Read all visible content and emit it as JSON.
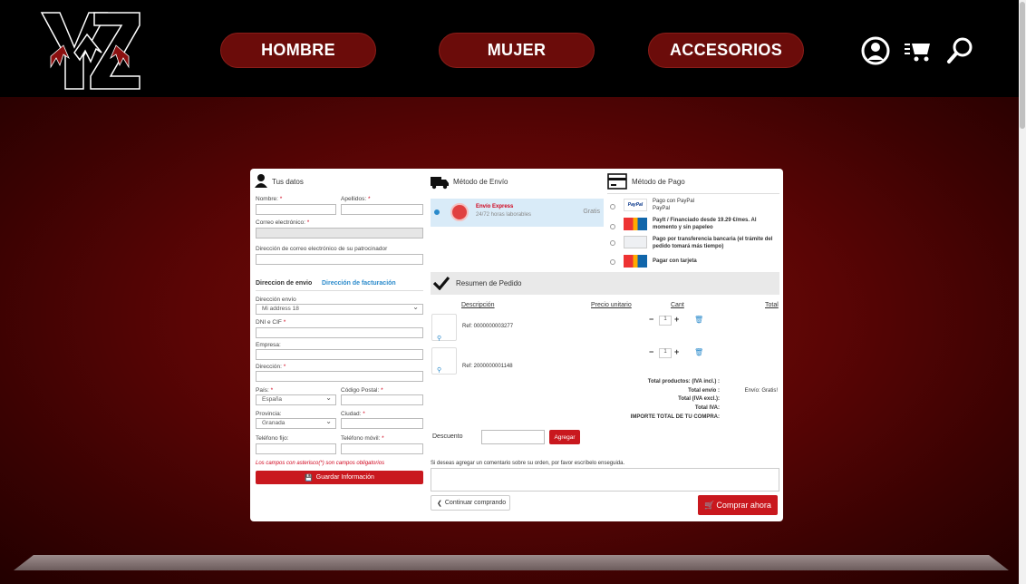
{
  "nav": {
    "hombre": "HOMBRE",
    "mujer": "MUJER",
    "accesorios": "ACCESORIOS"
  },
  "colors": {
    "brand_dark": "#6b0c0a",
    "accent_red": "#c9181e",
    "link_blue": "#2a8acb"
  },
  "datos": {
    "title": "Tus datos",
    "nombre": "Nombre: ",
    "apellidos": "Apellidos: ",
    "correo": "Correo electrónico: ",
    "correo_padrinador": "Dirección de correo electrónico de su patrocinador",
    "tab_envio": "Direccion de envio",
    "tab_facturacion": "Dirección de facturación",
    "direccion_envio": "Dirección envío",
    "direccion_envio_value": "Mi address 18",
    "dni": "DNI e CIF ",
    "empresa": "Empresa:",
    "direccion": "Dirección: ",
    "pais": "País: ",
    "pais_value": "España",
    "cp": "Código Postal: ",
    "provincia": "Provincia:",
    "provincia_value": "Granada",
    "ciudad": "Ciudad: ",
    "tel_fijo": "Teléfono fijo:",
    "tel_movil": "Teléfono móvil: ",
    "nota": "Los campos con asterisco(*) son campos obligatorios",
    "guardar": "Guardar Información",
    "asterisk": "*"
  },
  "envio": {
    "title": "Método de Envío",
    "option_name": "Envío Express",
    "option_desc": "24/72 horas laborables",
    "option_price": "Gratis"
  },
  "pago": {
    "title": "Método de Pago",
    "options": [
      {
        "label": "Pago con PayPal",
        "sub": "PayPal",
        "icon": "PayPal"
      },
      {
        "label": "Paylt / Financiado desde 19.29 €/mes. Al momento y sin papeleo",
        "sub": ""
      },
      {
        "label": "Pago por transferencia bancaria (el trámite del pedido tomará más tiempo)",
        "sub": ""
      },
      {
        "label": "Pagar con tarjeta",
        "sub": ""
      }
    ]
  },
  "resumen": {
    "title": "Resumen de Pedido",
    "headers": {
      "descripcion": "Descripción",
      "precio": "Precio unitario",
      "cant": "Cant",
      "total": "Total"
    },
    "items": [
      {
        "ref": "Ref: 0000000003277",
        "qty": "1"
      },
      {
        "ref": "Ref: 2000000001148",
        "qty": "1"
      }
    ],
    "totales": {
      "productos": "Total productos: (IVA incl.) :",
      "envio": "Total envío :",
      "envio_value": "Envío: Gratis!",
      "sin_iva": "Total (IVA excl.):",
      "iva": "Total IVA:",
      "importe": "IMPORTE TOTAL DE TU COMPRA:"
    },
    "descuento": "Descuento",
    "agregar": "Agregar",
    "comentario": "Si deseas agregar un comentario sobre su orden, por favor escríbelo enseguida.",
    "continuar": "Continuar comprando",
    "comprar": "Comprar ahora"
  }
}
